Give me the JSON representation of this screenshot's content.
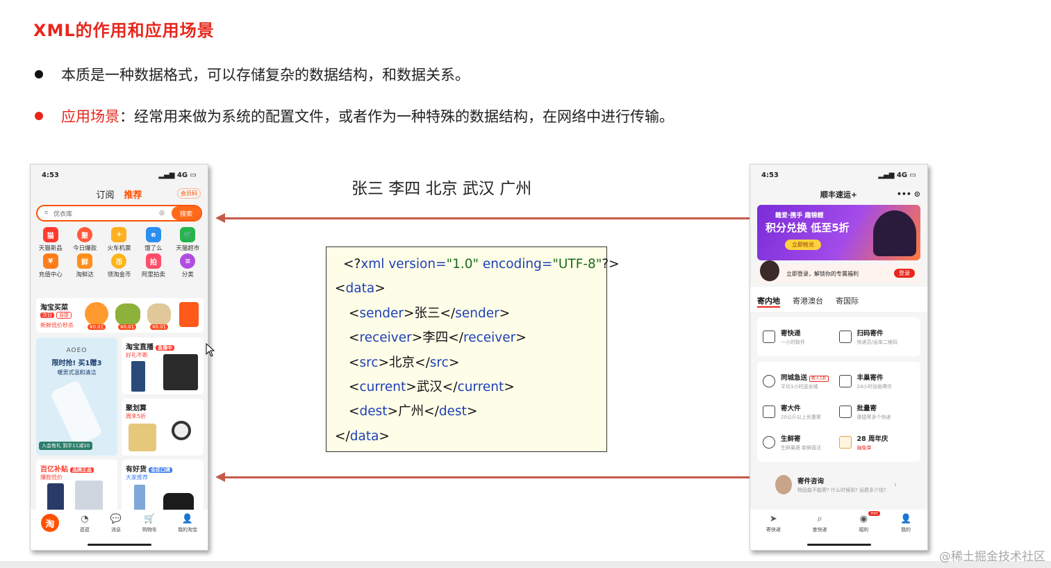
{
  "slide": {
    "title": "XML的作用和应用场景",
    "bullet1": "本质是一种数据格式，可以存储复杂的数据结构，和数据关系。",
    "bullet2_label": "应用场景",
    "bullet2_text": "：经常用来做为系统的配置文件，或者作为一种特殊的数据结构，在网络中进行传输。",
    "names_line": "张三 李四 北京 武汉 广州",
    "watermark": "@稀土掘金技术社区"
  },
  "xml": {
    "decl_open": "<?",
    "decl_name": "xml version=",
    "decl_version": "\"1.0\"",
    "decl_enc": " encoding=",
    "decl_enc_val": "\"UTF-8\"",
    "decl_close": "?>",
    "root_open": "data",
    "root_close": "data",
    "fields": [
      {
        "tag": "sender",
        "value": "张三"
      },
      {
        "tag": "receiver",
        "value": "李四"
      },
      {
        "tag": "src",
        "value": "北京"
      },
      {
        "tag": "current",
        "value": "武汉"
      },
      {
        "tag": "dest",
        "value": "广州"
      }
    ]
  },
  "left_phone": {
    "time": "4:53",
    "signal": "4G",
    "tab_subscribe": "订阅",
    "tab_recommend": "推荐",
    "member_badge": "会员码",
    "search_placeholder": "优衣库",
    "search_button": "搜索",
    "icons": [
      "天猫新品",
      "今日爆款",
      "火车机票",
      "饿了么",
      "天猫超市",
      "充值中心",
      "淘鲜达",
      "领淘金币",
      "阿里拍卖",
      "分类"
    ],
    "buy_card_title": "淘宝买菜",
    "buy_card_sub": "新鲜低价秒杀",
    "buy_card_tag1": "次日",
    "buy_card_tag2": "自提",
    "price": "¥0.01",
    "ad_brand": "AOEO",
    "ad_line1": "限时抢! 买1赠3",
    "ad_line2": "暖男式温和清洁",
    "ad_footer": "入会有礼 到手11减10",
    "live_title": "淘宝直播",
    "live_tag": "直播中",
    "live_sub": "好礼不断",
    "juhuasuan_title": "聚划算",
    "juhuasuan_sub": "周末5折",
    "subsidy_title": "百亿补贴",
    "subsidy_tag": "品牌正品",
    "subsidy_sub": "爆款低价",
    "goods_title": "有好货",
    "goods_tag": "全民口碑",
    "goods_sub": "大家推荐",
    "nav": [
      "逛逛",
      "消息",
      "购物车",
      "我的淘宝"
    ],
    "nav_home": "淘"
  },
  "right_phone": {
    "time": "4:53",
    "signal": "4G",
    "header_title": "顺丰速运+",
    "banner_line1": "籍爱·携手 趣锦鲤",
    "banner_line2": "积分兑换 低至5折",
    "banner_button": "立即抢兑",
    "login_text": "立即登录，解锁你的专属福利",
    "login_button": "登录",
    "tabs": [
      "寄内地",
      "寄港澳台",
      "寄国际"
    ],
    "top_services": [
      {
        "name": "寄快递",
        "desc": "一小时取件"
      },
      {
        "name": "扫码寄件",
        "desc": "快递员/运单二维码"
      }
    ],
    "services": [
      {
        "name": "同城急送",
        "desc": "平均1小时送全城",
        "tag": "新人5折"
      },
      {
        "name": "丰巢寄件",
        "desc": "24小时自助寄件"
      },
      {
        "name": "寄大件",
        "desc": "20公斤以上优惠寄"
      },
      {
        "name": "批量寄",
        "desc": "便捷寄多个快递"
      },
      {
        "name": "生鲜寄",
        "desc": "生鲜果蔬 新鲜直达"
      },
      {
        "name": "28 周年庆",
        "desc": "抽免单"
      }
    ],
    "consult_title": "寄件咨询",
    "consult_sub": "物品能不能寄? 什么时候到? 运费多少钱?",
    "nav": [
      "寄快递",
      "查快递",
      "福利",
      "我的"
    ],
    "nav_hot": "Hot"
  }
}
